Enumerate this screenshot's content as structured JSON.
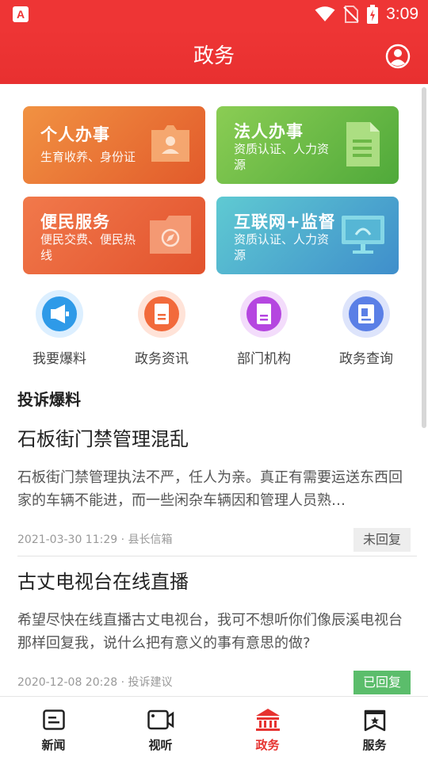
{
  "status": {
    "time": "3:09",
    "app_badge": "A"
  },
  "header": {
    "title": "政务"
  },
  "cards": [
    {
      "title": "个人办事",
      "subtitle": "生育收养、身份证"
    },
    {
      "title": "法人办事",
      "subtitle": "资质认证、人力资源"
    },
    {
      "title": "便民服务",
      "subtitle": "便民交费、便民热线"
    },
    {
      "title": "互联网+监督",
      "subtitle": "资质认证、人力资源"
    }
  ],
  "quick": [
    {
      "label": "我要爆料",
      "icon": "megaphone-icon"
    },
    {
      "label": "政务资讯",
      "icon": "document-icon"
    },
    {
      "label": "部门机构",
      "icon": "book-icon"
    },
    {
      "label": "政务查询",
      "icon": "search-doc-icon"
    }
  ],
  "section": {
    "title": "投诉爆料"
  },
  "news": [
    {
      "title": "石板街门禁管理混乱",
      "desc": "石板街门禁管理执法不严，任人为亲。真正有需要运送东西回家的车辆不能进，而一些闲杂车辆因和管理人员熟…",
      "date": "2021-03-30 11:29",
      "category": "县长信箱",
      "status": "未回复"
    },
    {
      "title": "古丈电视台在线直播",
      "desc": "希望尽快在线直播古丈电视台，我可不想听你们像辰溪电视台那样回复我，说什么把有意义的事有意思的做?",
      "date": "2020-12-08 20:28",
      "category": "投诉建议",
      "status": "已回复"
    }
  ],
  "tabs": [
    {
      "label": "新闻",
      "icon": "news-icon"
    },
    {
      "label": "视听",
      "icon": "video-icon"
    },
    {
      "label": "政务",
      "icon": "government-icon",
      "active": true
    },
    {
      "label": "服务",
      "icon": "service-icon"
    }
  ],
  "colors": {
    "primary": "#ee3535",
    "active_tab": "#e63330",
    "replied": "#5bbd6b"
  }
}
